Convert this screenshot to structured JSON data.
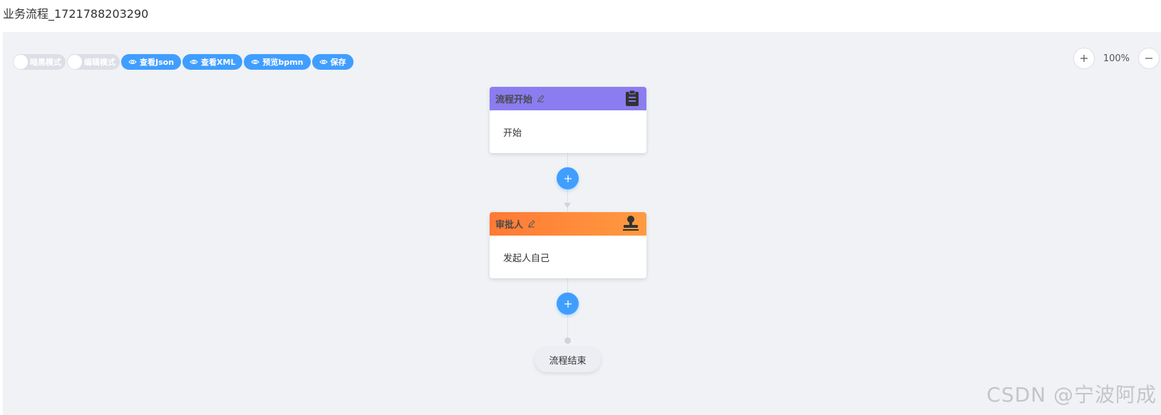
{
  "page": {
    "title": "业务流程_1721788203290"
  },
  "toolbar": {
    "dark_mode_label": "暗黑模式",
    "edit_mode_label": "编辑模式",
    "view_json_label": "查看Json",
    "view_xml_label": "查看XML",
    "preview_bpmn_label": "预览bpmn",
    "save_label": "保存"
  },
  "zoom": {
    "level": "100%"
  },
  "nodes": [
    {
      "title": "流程开始",
      "content": "开始",
      "header_color": "#8b7cf0",
      "icon": "clipboard-icon"
    },
    {
      "title": "审批人",
      "content": "发起人自己",
      "header_color": "#ff8a3d",
      "icon": "stamp-icon"
    }
  ],
  "end_node": {
    "label": "流程结束"
  },
  "watermark": {
    "text": "CSDN @宁波阿成"
  },
  "colors": {
    "primary": "#409eff",
    "canvas_bg": "#f0f2f5"
  }
}
